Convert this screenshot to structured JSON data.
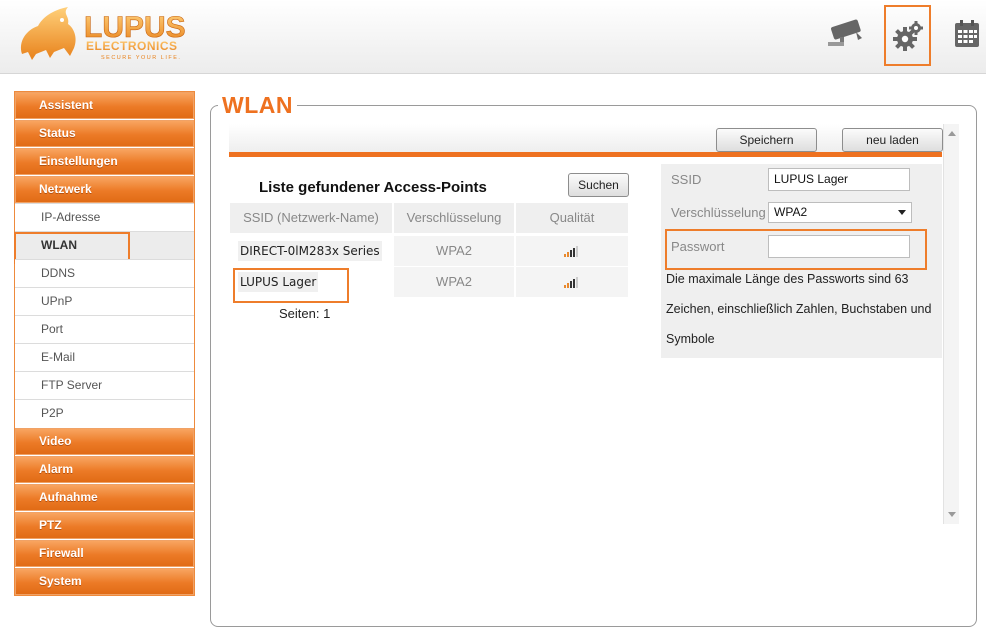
{
  "header": {
    "logo": {
      "brand": "LUPUS",
      "sub": "ELECTRONICS",
      "slogan": "SECURE YOUR LIFE."
    },
    "icons": {
      "camera": "camera-icon",
      "settings": "gear-icon",
      "calendar": "calendar-icon"
    }
  },
  "sidebar": {
    "items": [
      {
        "label": "Assistent",
        "level": "main"
      },
      {
        "label": "Status",
        "level": "main"
      },
      {
        "label": "Einstellungen",
        "level": "main"
      },
      {
        "label": "Netzwerk",
        "level": "main"
      },
      {
        "label": "IP-Adresse",
        "level": "sub"
      },
      {
        "label": "WLAN",
        "level": "sub",
        "active": true
      },
      {
        "label": "DDNS",
        "level": "sub"
      },
      {
        "label": "UPnP",
        "level": "sub"
      },
      {
        "label": "Port",
        "level": "sub"
      },
      {
        "label": "E-Mail",
        "level": "sub"
      },
      {
        "label": "FTP Server",
        "level": "sub"
      },
      {
        "label": "P2P",
        "level": "sub"
      },
      {
        "label": "Video",
        "level": "main"
      },
      {
        "label": "Alarm",
        "level": "main"
      },
      {
        "label": "Aufnahme",
        "level": "main"
      },
      {
        "label": "PTZ",
        "level": "main"
      },
      {
        "label": "Firewall",
        "level": "main"
      },
      {
        "label": "System",
        "level": "main"
      }
    ]
  },
  "main": {
    "title": "WLAN",
    "toolbar": {
      "save_label": "Speichern",
      "reload_label": "neu laden"
    },
    "ap_list": {
      "title": "Liste gefundener Access-Points",
      "search_label": "Suchen",
      "columns": [
        "SSID (Netzwerk-Name)",
        "Verschlüsselung",
        "Qualität"
      ],
      "rows": [
        {
          "ssid": "DIRECT-0lM283x Series",
          "encryption": "WPA2",
          "quality": 4
        },
        {
          "ssid": "LUPUS Lager",
          "encryption": "WPA2",
          "quality": 4
        }
      ],
      "pages": "Seiten: 1"
    },
    "form": {
      "ssid_label": "SSID",
      "ssid_value": "LUPUS Lager",
      "encryption_label": "Verschlüsselung",
      "encryption_value": "WPA2",
      "password_label": "Passwort",
      "password_value": "",
      "password_hint": "Die maximale Länge des Passworts sind 63 Zeichen, einschließlich Zahlen, Buchstaben und Symbole"
    }
  },
  "colors": {
    "accent": "#ee7120",
    "highlight": "#ee7d2b",
    "signal_low": "#e8892e",
    "signal_high": "#333333"
  }
}
